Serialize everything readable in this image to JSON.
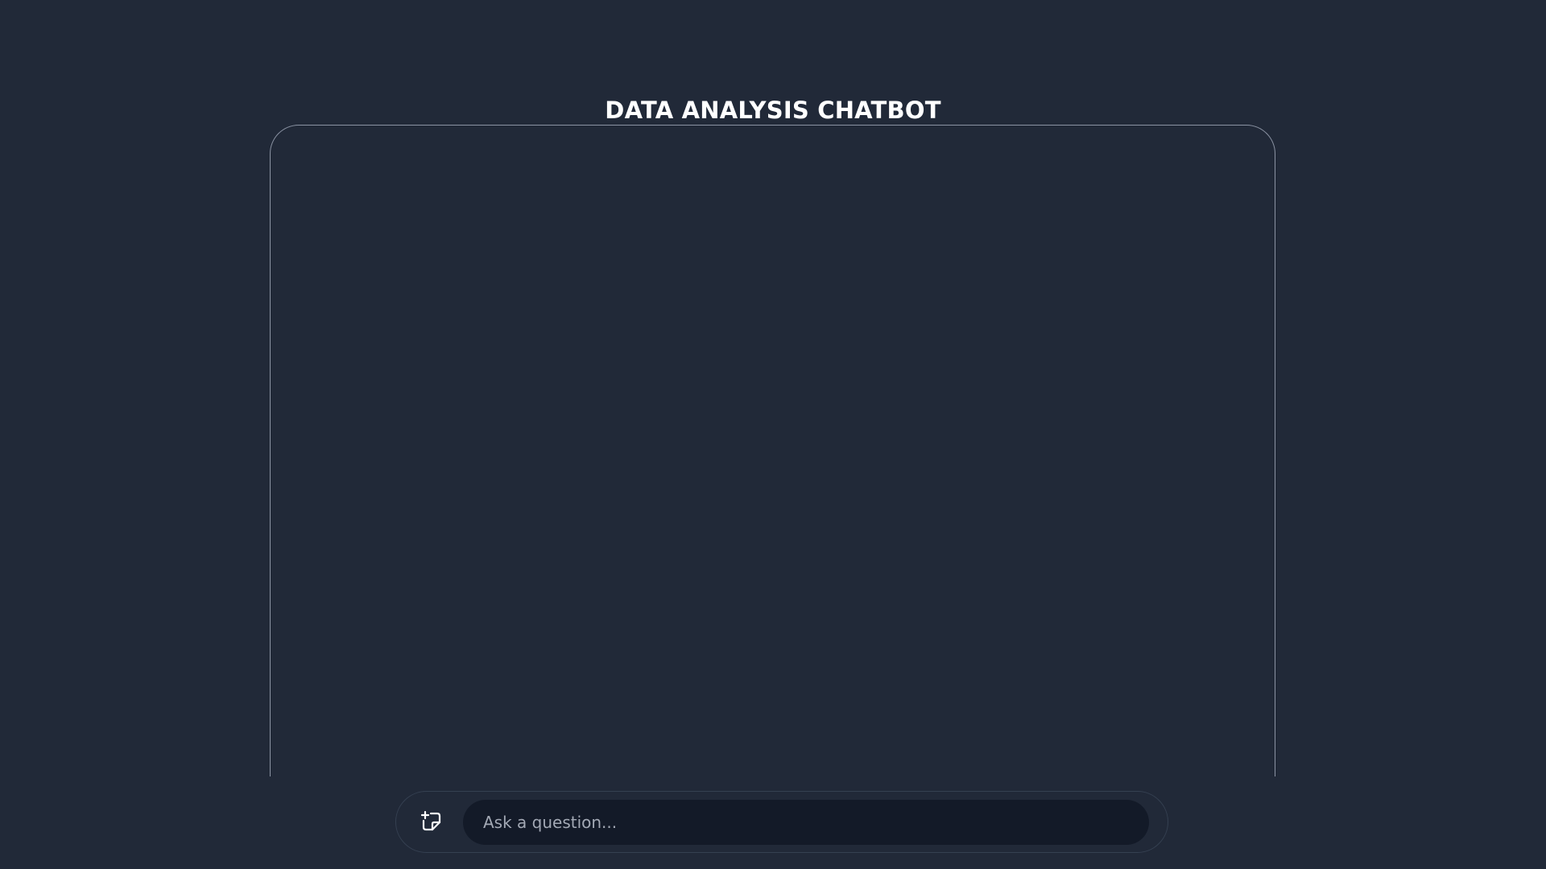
{
  "header": {
    "title": "DATA ANALYSIS CHATBOT"
  },
  "chat": {
    "messages": []
  },
  "composer": {
    "new_chat_icon": "new-chat-icon",
    "input_placeholder": "Ask a question...",
    "input_value": ""
  },
  "theme": {
    "background": "#212938",
    "panel_border": "#8b93a3",
    "input_background": "#131a28",
    "text": "#ffffff"
  }
}
